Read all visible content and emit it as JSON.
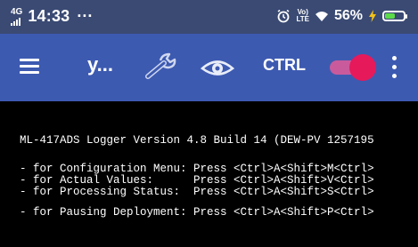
{
  "status_bar": {
    "network_type": "4G",
    "time": "14:33",
    "more": "···",
    "alarm_icon": "alarm-icon",
    "volte": [
      "Vo)",
      "LTE"
    ],
    "battery_percent": "56%",
    "battery_level": 0.56,
    "battery_color": "#5cdb4a"
  },
  "toolbar": {
    "title": "y...",
    "ctrl_label": "CTRL",
    "toggle_on": true,
    "colors": {
      "background": "#3d5ab1",
      "toggle_thumb": "#e6195b",
      "toggle_track": "#c95b9c"
    }
  },
  "terminal": {
    "lines": [
      "ML-417ADS Logger Version 4.8 Build 14 (DEW-PV 1257195",
      "- for Configuration Menu: Press <Ctrl>A<Shift>M<Ctrl>",
      "- for Actual Values:      Press <Ctrl>A<Shift>V<Ctrl>",
      "- for Processing Status:  Press <Ctrl>A<Shift>S<Ctrl>",
      "- for Pausing Deployment: Press <Ctrl>A<Shift>P<Ctrl>"
    ]
  }
}
